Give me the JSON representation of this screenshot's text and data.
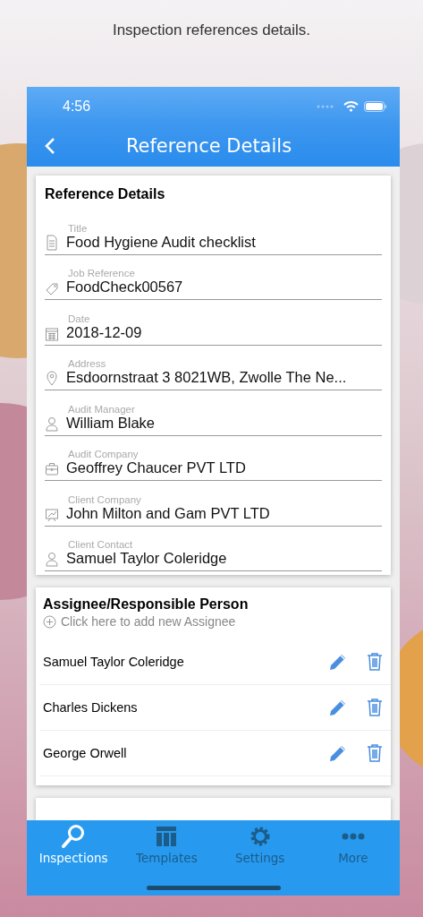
{
  "caption": "Inspection references details.",
  "status_bar": {
    "time": "4:56"
  },
  "nav_bar": {
    "title": "Reference Details"
  },
  "reference_card": {
    "title": "Reference Details",
    "fields": [
      {
        "label": "Title",
        "value": "Food Hygiene Audit checklist"
      },
      {
        "label": "Job Reference",
        "value": "FoodCheck00567"
      },
      {
        "label": "Date",
        "value": "2018-12-09"
      },
      {
        "label": "Address",
        "value": "Esdoornstraat 3 8021WB, Zwolle The Ne..."
      },
      {
        "label": "Audit Manager",
        "value": "William Blake"
      },
      {
        "label": "Audit Company",
        "value": "Geoffrey Chaucer PVT LTD"
      },
      {
        "label": "Client Company",
        "value": "John Milton and Gam PVT LTD"
      },
      {
        "label": "Client Contact",
        "value": "Samuel Taylor Coleridge"
      }
    ]
  },
  "assignee_card": {
    "title": "Assignee/Responsible Person",
    "add_link": "Click here to add new Assignee",
    "assignees": [
      {
        "name": "Samuel Taylor Coleridge"
      },
      {
        "name": "Charles Dickens"
      },
      {
        "name": "George Orwell"
      }
    ]
  },
  "tab_bar": [
    {
      "label": "Inspections",
      "selected": true
    },
    {
      "label": "Templates",
      "selected": false
    },
    {
      "label": "Settings",
      "selected": false
    },
    {
      "label": "More",
      "selected": false
    }
  ]
}
